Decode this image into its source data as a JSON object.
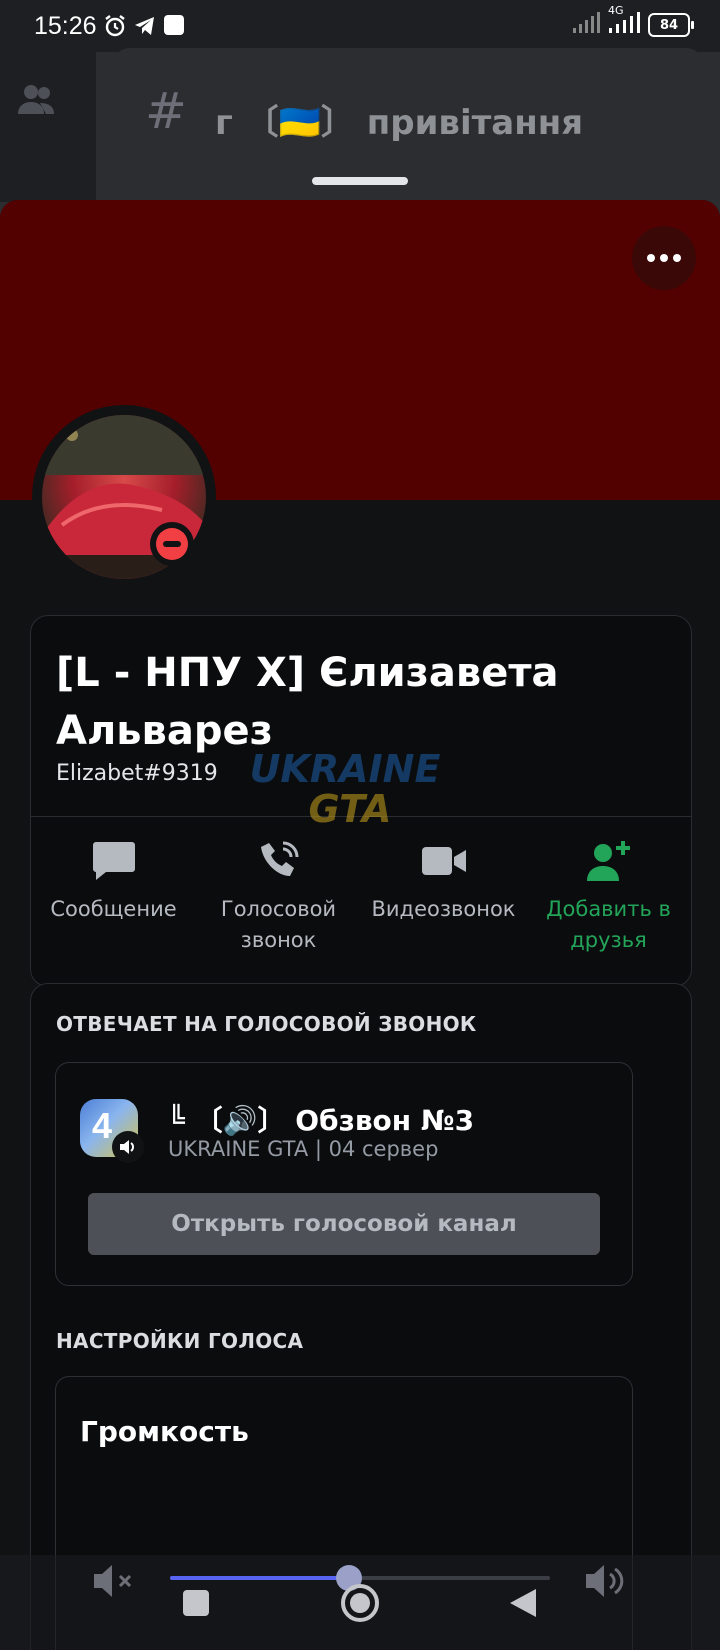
{
  "status_bar": {
    "time": "15:26",
    "network": "4G",
    "battery": "84"
  },
  "background": {
    "channel_hash": "#",
    "channel_title": "г 〔🇺🇦〕 привітання"
  },
  "profile": {
    "display_name": "[L - НПУ X] Єлизавета Альварез",
    "username": "Elizabet#9319",
    "status": "do-not-disturb",
    "banner_color": "#530000",
    "actions": [
      {
        "label": "Сообщение",
        "icon": "message-icon"
      },
      {
        "label": "Голосовой звонок",
        "icon": "phone-call-icon"
      },
      {
        "label": "Видеозвонок",
        "icon": "video-camera-icon"
      },
      {
        "label": "Добавить в друзья",
        "icon": "add-friend-icon"
      }
    ]
  },
  "voice_activity": {
    "section_title": "ОТВЕЧАЕТ НА ГОЛОСОВОЙ ЗВОНОК",
    "channel_name": "╚ 〔🔊〕 Обзвон №3",
    "server_name": "UKRAINE GTA | 04 сервер",
    "server_icon_char": "4",
    "open_button": "Открыть голосовой канал"
  },
  "voice_settings": {
    "section_title": "НАСТРОЙКИ ГОЛОСА",
    "volume_label": "Громкость",
    "volume_fraction": 0.47
  },
  "watermark": {
    "line1": "UKRAINE",
    "line2": "GTA"
  }
}
